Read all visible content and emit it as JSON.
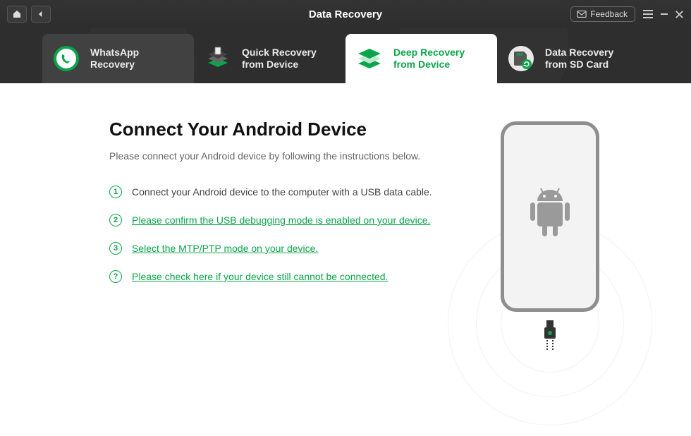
{
  "header": {
    "title": "Data Recovery",
    "feedback_label": "Feedback"
  },
  "tabs": [
    {
      "line1": "WhatsApp",
      "line2": "Recovery",
      "icon": "whatsapp",
      "state": "selected"
    },
    {
      "line1": "Quick Recovery",
      "line2": "from Device",
      "icon": "quick",
      "state": ""
    },
    {
      "line1": "Deep Recovery",
      "line2": "from Device",
      "icon": "deep",
      "state": "active"
    },
    {
      "line1": "Data Recovery",
      "line2": "from SD Card",
      "icon": "sdcard",
      "state": ""
    }
  ],
  "main": {
    "heading": "Connect Your Android Device",
    "subtitle": "Please connect your Android device by following the instructions below.",
    "steps": [
      {
        "num": "1",
        "type": "text",
        "text": "Connect your Android device to the computer with a USB data cable."
      },
      {
        "num": "2",
        "type": "link",
        "text": "Please confirm the USB debugging mode is enabled on your device."
      },
      {
        "num": "3",
        "type": "link",
        "text": "Select the MTP/PTP mode on your device."
      },
      {
        "num": "?",
        "type": "link",
        "text": "Please check here if your device still cannot be connected."
      }
    ]
  }
}
